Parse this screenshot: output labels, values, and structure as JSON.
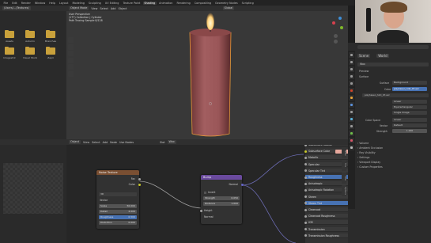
{
  "menubar": {
    "items": [
      "File",
      "Edit",
      "Render",
      "Window",
      "Help",
      "Layout",
      "Modeling",
      "Sculpting",
      "UV Editing",
      "Texture Paint",
      "Shading",
      "Animation",
      "Rendering",
      "Compositing",
      "Geometry Nodes",
      "Scripting"
    ],
    "active_index": 10
  },
  "file_browser": {
    "path": "/Users/…/Textures/",
    "folders": [
      "Assets",
      "Autumn",
      "Branches",
      "Imagestck",
      "Visual Studio",
      "Zapri"
    ]
  },
  "viewport": {
    "header_items": [
      "Object Mode",
      "View",
      "Select",
      "Add",
      "Object"
    ],
    "orientation": "Global",
    "info_lines": [
      "User Perspective",
      "(177) Collection | Cylinder",
      "Path Tracing Sample 8/128"
    ]
  },
  "properties": {
    "search_placeholder": "",
    "tabs": [
      "Scene",
      "World"
    ],
    "object_name": "Wax",
    "sections": [
      "Preview",
      "Surface"
    ],
    "surface_label": "Surface",
    "surface_value": "Background",
    "color_label": "Color",
    "color_value": "polyhaven_hdri_07.exr",
    "image_name": "polyhaven_hdri_07.exr",
    "interp": "Linear",
    "proj": "Equirectangular",
    "ext": "Single Image",
    "color_space_label": "Color Space",
    "color_space_value": "Linear",
    "vector_label": "Vector",
    "vector_value": "Default",
    "strength_label": "Strength",
    "strength_value": "1.000",
    "subsections": [
      "Volume",
      "Ambient Occlusion",
      "Ray Visibility",
      "Settings",
      "Viewport Display",
      "Custom Properties"
    ]
  },
  "node_editor": {
    "header_items": [
      "Object",
      "View",
      "Select",
      "Add",
      "Node",
      "Use Nodes",
      "Slot",
      "Wax"
    ],
    "noise_node": {
      "title": "Noise Texture",
      "out_fac": "Fac",
      "out_color": "Color",
      "dim": "3D",
      "vector": "Vector",
      "scale_label": "Scale",
      "scale_value": "50.000",
      "detail_label": "Detail",
      "detail_value": "2.000",
      "rough_label": "Roughness",
      "rough_value": "0.500",
      "distort_label": "Distortion",
      "distort_value": "0.000"
    },
    "bump_node": {
      "title": "Bump",
      "out_normal": "Normal",
      "invert": "Invert",
      "strength_label": "Strength",
      "strength_value": "0.050",
      "distance_label": "Distance",
      "distance_value": "1.000",
      "height": "Height",
      "normal": "Normal"
    },
    "bsdf_rows": [
      "Subsurface Radius",
      "Subsurface Color",
      "Metallic",
      "Specular",
      "Specular Tint",
      "Roughness",
      "Anisotropic",
      "Anisotropic Rotation",
      "Sheen",
      "Sheen Tint",
      "Clearcoat",
      "Clearcoat Roughness",
      "IOR",
      "Transmission",
      "Transmission Roughness"
    ],
    "highlighted_rows": [
      5,
      9
    ],
    "side_tabs": [
      "Node",
      "Tool",
      "View",
      "Options"
    ]
  },
  "colors": {
    "candle": "#9a5658",
    "flame": "#ffe9a8",
    "node_noise": "#7a4f32",
    "node_bump": "#6a4a9e",
    "accent": "#4772b3",
    "subsurface_swatch": "#e6a79c"
  }
}
